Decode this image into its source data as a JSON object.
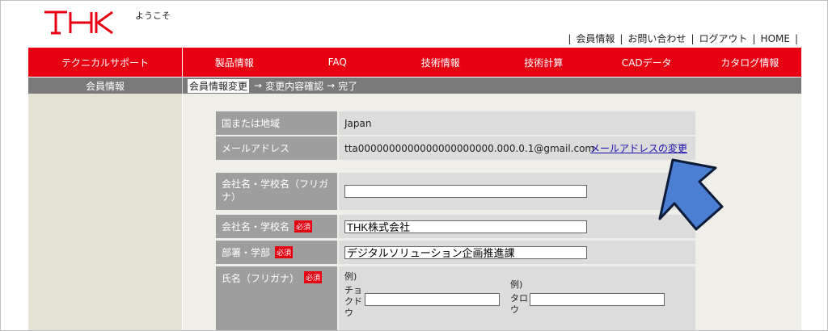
{
  "header": {
    "logo_text": "THK",
    "welcome": "ようこそ",
    "links": [
      "会員情報",
      "お問い合わせ",
      "ログアウト",
      "HOME"
    ]
  },
  "nav": {
    "left": "テクニカルサポート",
    "items": [
      "製品情報",
      "FAQ",
      "技術情報",
      "技術計算",
      "CADデータ",
      "カタログ情報"
    ]
  },
  "subnav": {
    "left": "会員情報",
    "steps": [
      "会員情報変更",
      "変更内容確認",
      "完了"
    ]
  },
  "form": {
    "country_label": "国または地域",
    "country_value": "Japan",
    "email_label": "メールアドレス",
    "email_value": "tta0000000000000000000000.000.0.1@gmail.com",
    "email_change_link": "メールアドレスの変更",
    "company_kana_label": "会社名・学校名（フリガナ）",
    "company_kana_value": "",
    "company_label": "会社名・学校名",
    "company_value": "THK株式会社",
    "dept_label": "部署・学部",
    "dept_value": "デジタルソリューション企画推進課",
    "name_kana_label": "氏名（フリガナ）",
    "required_badge": "必須",
    "example_prefix": "例)",
    "example_last": "チョクドウ",
    "example_first": "タロウ"
  },
  "colors": {
    "brand_red": "#e60012",
    "sub_gray": "#7a7a7a",
    "label_gray": "#9e9e9e",
    "value_gray": "#dcdcdc",
    "arrow_blue": "#4a7fd4"
  }
}
